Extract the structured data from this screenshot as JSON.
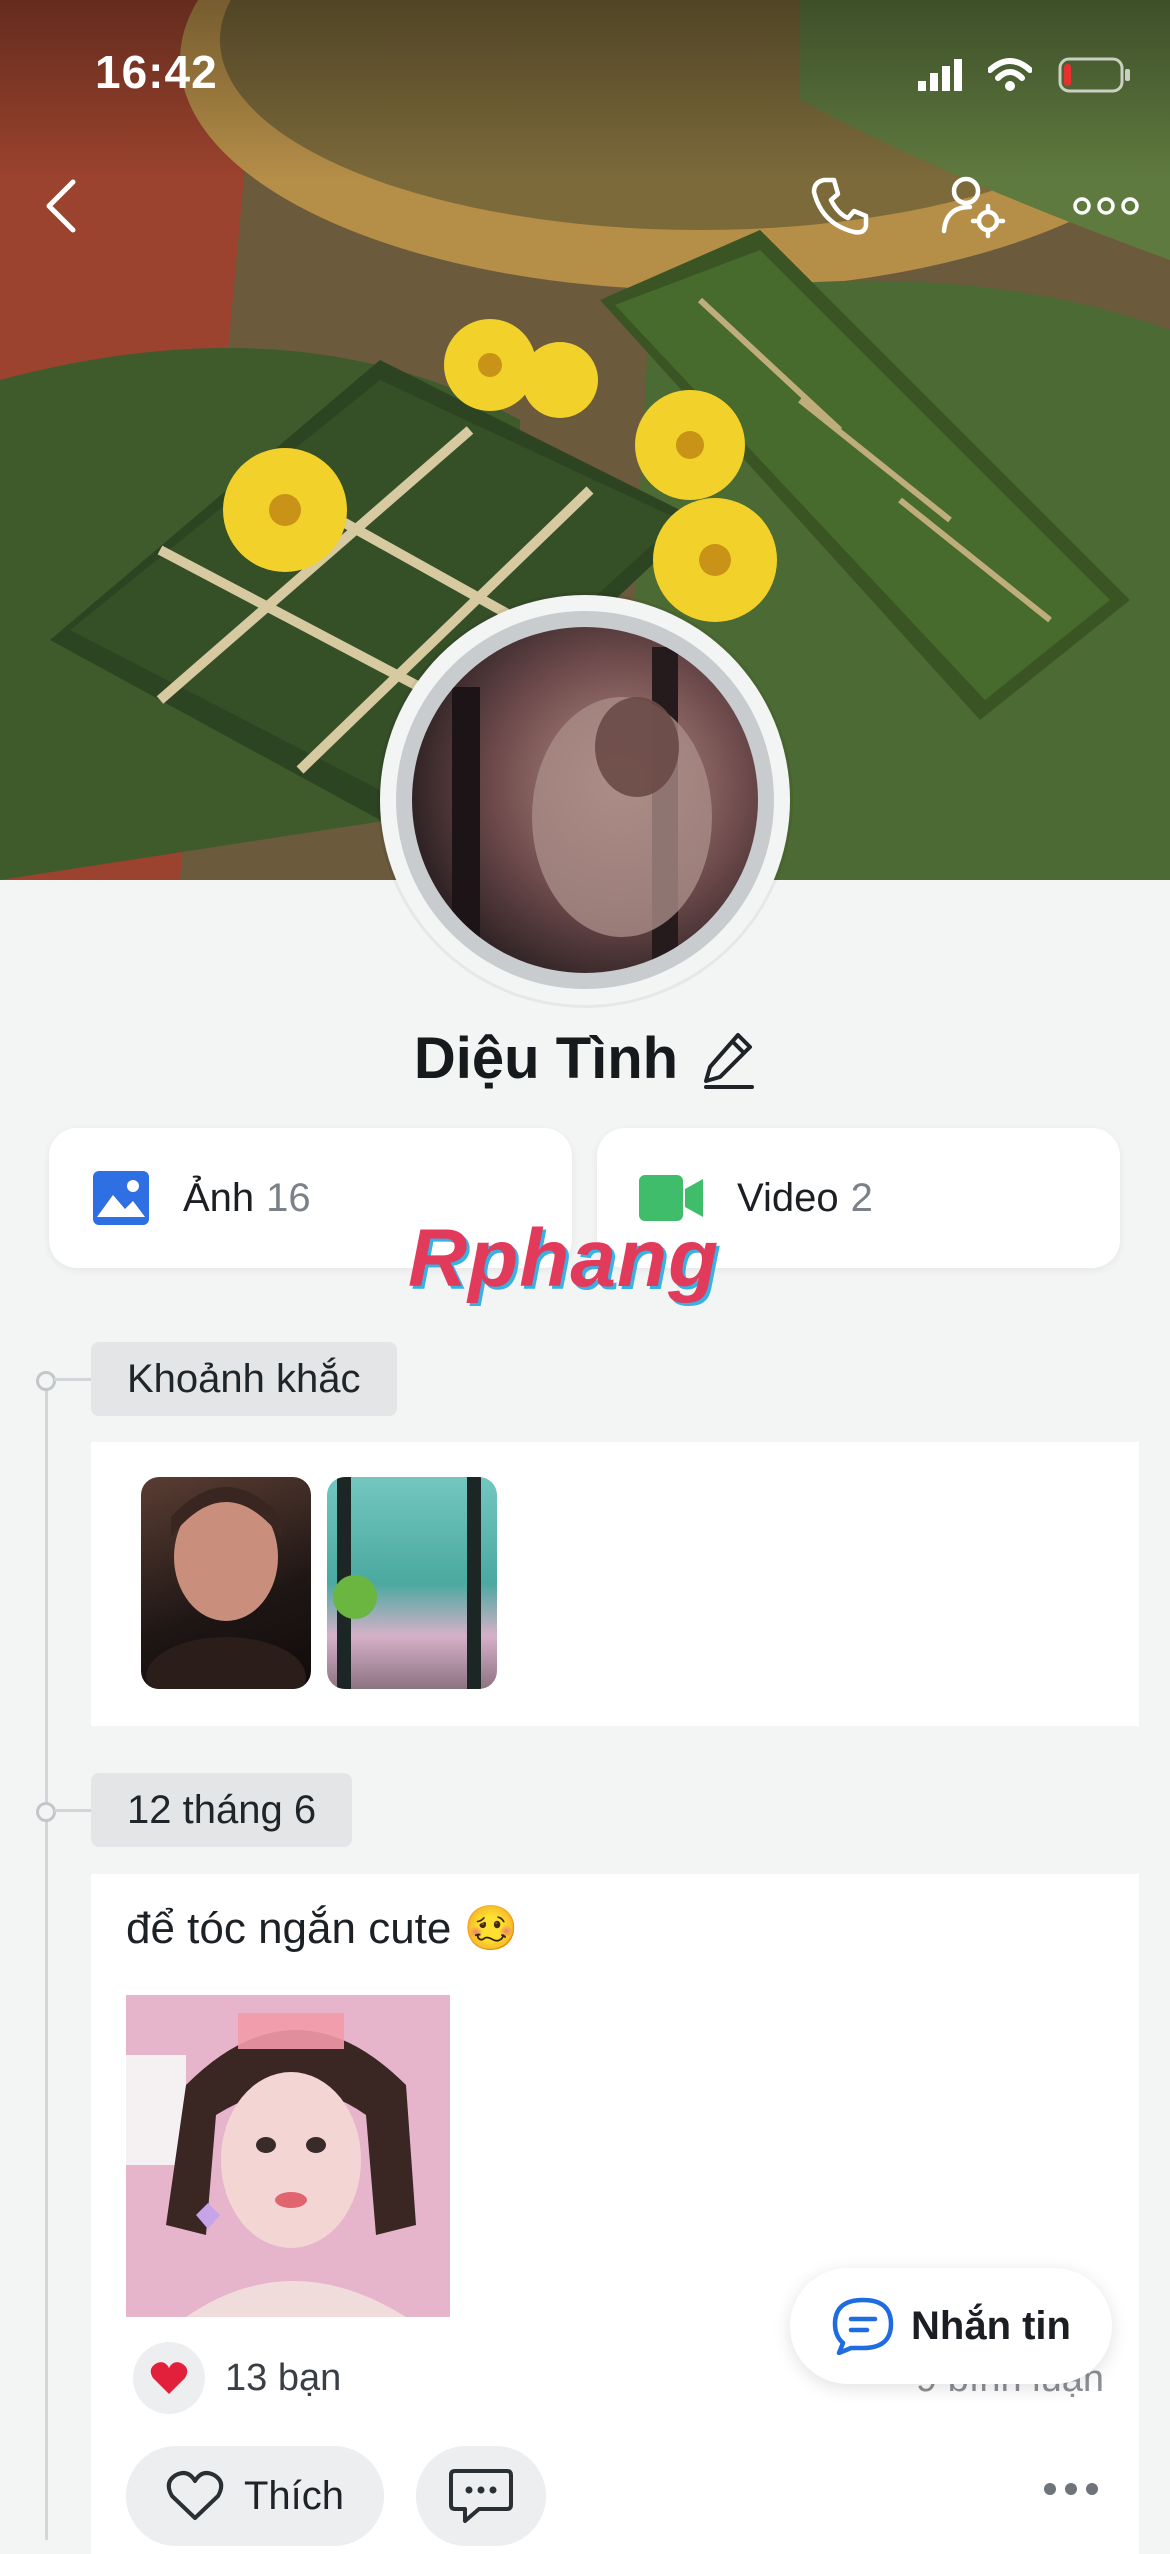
{
  "status_bar": {
    "time": "16:42"
  },
  "header": {
    "icons": {
      "back": "back-chevron-icon",
      "call": "phone-icon",
      "settings": "user-settings-icon",
      "more": "more-dots-icon"
    }
  },
  "profile": {
    "name": "Diệu Tình"
  },
  "media": {
    "photos": {
      "label": "Ảnh",
      "count": "16"
    },
    "videos": {
      "label": "Video",
      "count": "2"
    }
  },
  "watermark": {
    "text": "Rphang"
  },
  "moments": {
    "label": "Khoảnh khắc"
  },
  "post": {
    "date": "12 tháng 6",
    "text": "để tóc ngắn cute 🥴",
    "reactions": "13 bạn",
    "comments": "9 bình luận",
    "like_label": "Thích"
  },
  "message_button": {
    "label": "Nhắn tin"
  },
  "colors": {
    "photo_icon": "#2f6fe4",
    "video_icon": "#3fbd6a",
    "heart": "#e3203b",
    "message_accent": "#1f6ce0"
  }
}
